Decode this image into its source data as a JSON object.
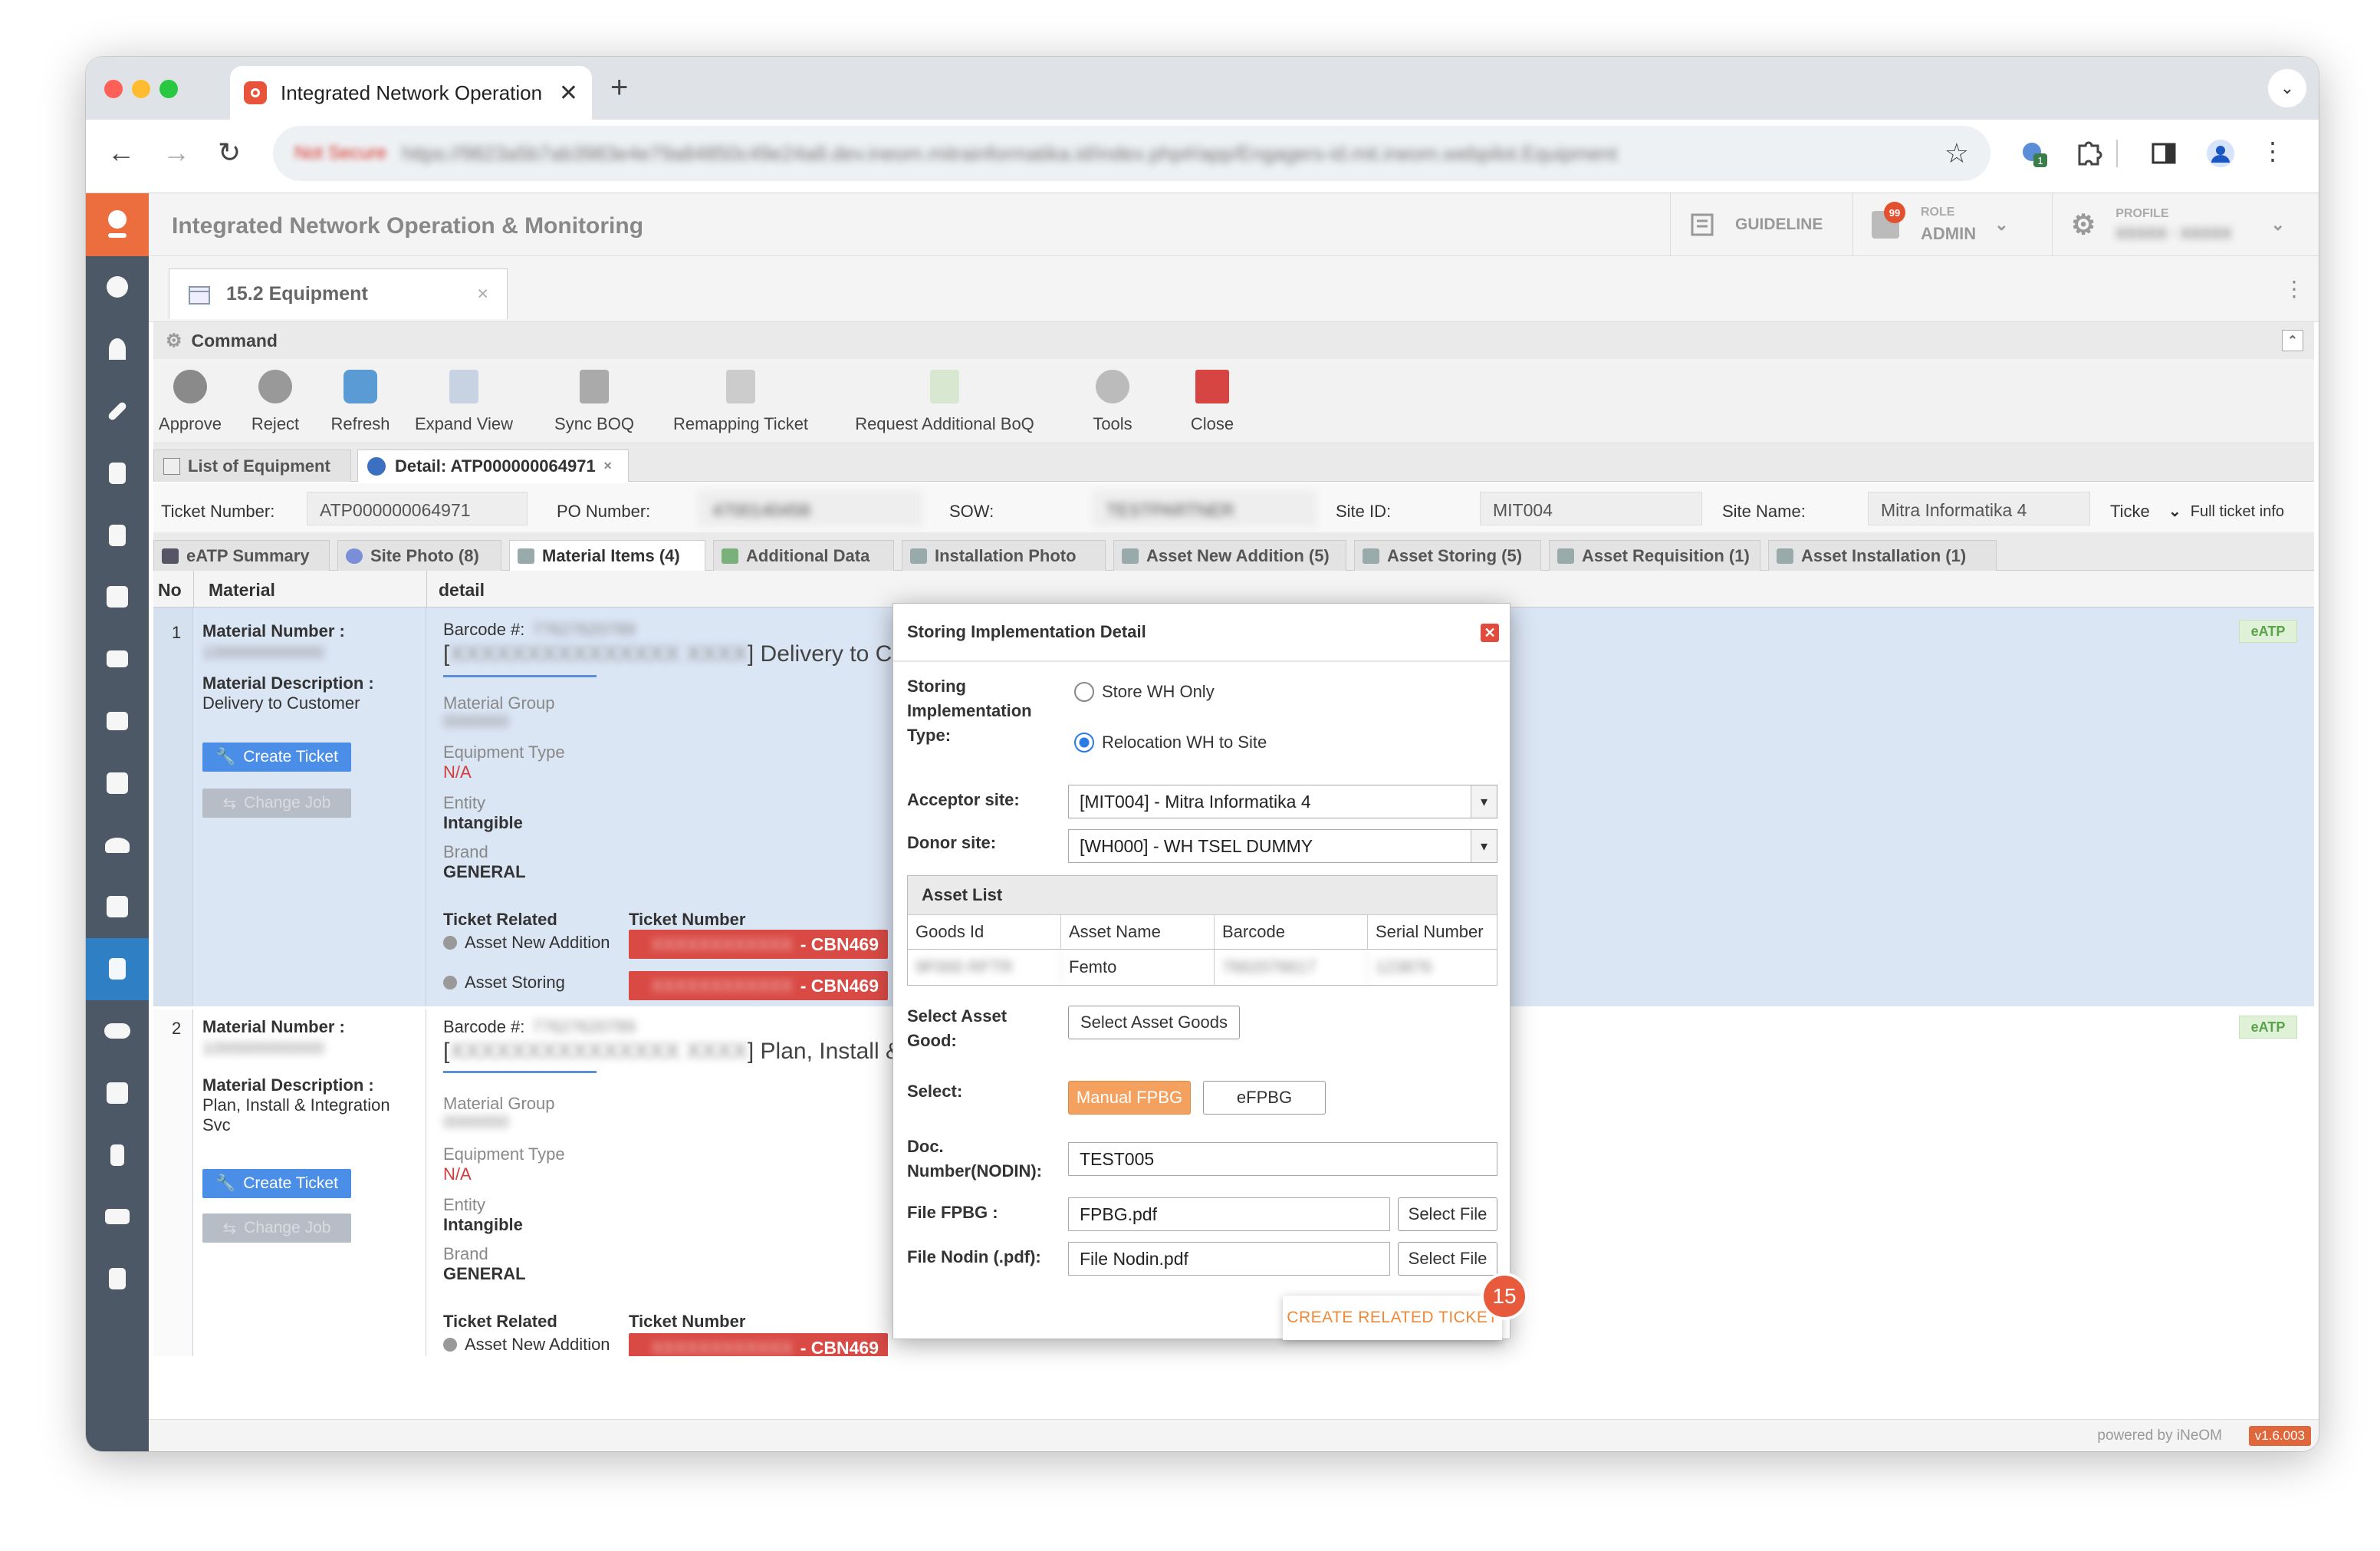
{
  "browser": {
    "tab_title": "Integrated Network Operation",
    "tab_close": "✕",
    "new_tab": "+",
    "not_secure": "Not Secure",
    "url": "https://9823a5b7ab3983e4e79a84850c49e24a8.dev.ineom.mitrainformatika.id/index.php#/app/Engagers-id.mit.ineom.webpilot.Equipment",
    "extension_badge": "1"
  },
  "app": {
    "title": "Integrated Network Operation & Monitoring",
    "guideline": "GUIDELINE",
    "notif_count": "99",
    "role_label": "ROLE",
    "role_value": "ADMIN",
    "profile_label": "PROFILE",
    "profile_value": "XXXXX · XXXXX",
    "page_tab": "15.2 Equipment",
    "page_tab_close": "×"
  },
  "command": {
    "header": "Command",
    "items": [
      {
        "label": "Approve"
      },
      {
        "label": "Reject"
      },
      {
        "label": "Refresh"
      },
      {
        "label": "Expand View"
      },
      {
        "label": "Sync BOQ"
      },
      {
        "label": "Remapping Ticket"
      },
      {
        "label": "Request Additional BoQ"
      },
      {
        "label": "Tools"
      },
      {
        "label": "Close"
      }
    ]
  },
  "subtabs": {
    "list": "List of Equipment",
    "detail": "Detail: ATP000000064971"
  },
  "ticket": {
    "number_label": "Ticket Number:",
    "number_value": "ATP000000064971",
    "po_label": "PO Number:",
    "po_value": "4700140458",
    "sow_label": "SOW:",
    "sow_value": "TESTPARTNER",
    "site_id_label": "Site ID:",
    "site_id_value": "MIT004",
    "site_name_label": "Site Name:",
    "site_name_value": "Mitra Informatika 4",
    "ticket_trunc": "Ticke",
    "full_info": "Full ticket info"
  },
  "content_tabs": [
    {
      "label": "eATP Summary"
    },
    {
      "label": "Site Photo (8)"
    },
    {
      "label": "Material Items (4)"
    },
    {
      "label": "Additional Data"
    },
    {
      "label": "Installation Photo"
    },
    {
      "label": "Asset New Addition (5)"
    },
    {
      "label": "Asset Storing (5)"
    },
    {
      "label": "Asset Requisition (1)"
    },
    {
      "label": "Asset Installation (1)"
    }
  ],
  "grid": {
    "col_no": "No",
    "col_material": "Material",
    "col_detail": "detail",
    "rows": [
      {
        "no": "1",
        "material_number_label": "Material Number :",
        "material_number_value": "1000000000000",
        "material_desc_label": "Material Description :",
        "material_desc_value": "Delivery to Customer",
        "create_ticket": "Create Ticket",
        "change_job": "Change Job",
        "barcode_label": "Barcode #:",
        "barcode_value": "77627620789",
        "detail_bracket_open": "[",
        "detail_code": "XXXXXXXXXXXXXXX XXXX",
        "detail_title": "] Delivery to Customer",
        "material_group_label": "Material Group",
        "material_group_value": "0000000",
        "equipment_type_label": "Equipment Type",
        "equipment_type_value": "N/A",
        "entity_label": "Entity",
        "entity_value": "Intangible",
        "brand_label": "Brand",
        "brand_value": "GENERAL",
        "ticket_related_label": "Ticket Related",
        "ticket_number_label": "Ticket Number",
        "tickets": [
          {
            "related": "Asset New Addition",
            "code": "- CBN469",
            "masked": "XXXXXXXXXXXX"
          },
          {
            "related": "Asset Storing",
            "code": "- CBN469",
            "masked": "XXXXXXXXXXXX"
          }
        ],
        "badge": "eATP"
      },
      {
        "no": "2",
        "material_number_label": "Material Number :",
        "material_number_value": "1000000000000",
        "material_desc_label": "Material Description :",
        "material_desc_value": "Plan, Install & Integration Svc",
        "create_ticket": "Create Ticket",
        "change_job": "Change Job",
        "barcode_label": "Barcode #:",
        "barcode_value": "77627620789",
        "detail_bracket_open": "[",
        "detail_code": "XXXXXXXXXXXXXXX XXXX",
        "detail_title": "] Plan, Install & Integ",
        "material_group_label": "Material Group",
        "material_group_value": "0000000",
        "equipment_type_label": "Equipment Type",
        "equipment_type_value": "N/A",
        "entity_label": "Entity",
        "entity_value": "Intangible",
        "brand_label": "Brand",
        "brand_value": "GENERAL",
        "ticket_related_label": "Ticket Related",
        "ticket_number_label": "Ticket Number",
        "tickets": [
          {
            "related": "Asset New Addition",
            "code": "- CBN469",
            "masked": "XXXXXXXXXXXX"
          }
        ],
        "badge": "eATP"
      }
    ]
  },
  "dialog": {
    "title": "Storing Implementation Detail",
    "close": "✕",
    "type_label": "Storing Implementation Type:",
    "opt_store": "Store WH Only",
    "opt_relocation": "Relocation WH to Site",
    "acceptor_label": "Acceptor site:",
    "acceptor_value": "[MIT004] - Mitra Informatika 4",
    "donor_label": "Donor site:",
    "donor_value": "[WH000] - WH TSEL DUMMY",
    "asset_list_title": "Asset List",
    "asset_cols": [
      "Goods Id",
      "Asset Name",
      "Barcode",
      "Serial Number"
    ],
    "asset_row": [
      "9F000 RFTR",
      "Femto",
      "7662076617",
      "123876"
    ],
    "select_asset_label": "Select Asset Good:",
    "select_asset_btn": "Select Asset Goods",
    "select_label": "Select:",
    "manual_fpbg": "Manual FPBG",
    "efpbg": "eFPBG",
    "doc_label": "Doc. Number(NODIN):",
    "doc_value": "TEST005",
    "file_fpbg_label": "File FPBG :",
    "file_fpbg_value": "FPBG.pdf",
    "file_nodin_label": "File Nodin (.pdf):",
    "file_nodin_value": "File Nodin.pdf",
    "select_file": "Select File",
    "create_btn": "CREATE RELATED TICKET",
    "step_badge": "15"
  },
  "footer": {
    "powered": "powered by iNeOM",
    "version": "v1.6.003"
  },
  "colors": {
    "sidebar": "#4c5866",
    "accent": "#ec6d3e",
    "primary": "#4a8ee8",
    "ticket_red": "#d94a45"
  }
}
